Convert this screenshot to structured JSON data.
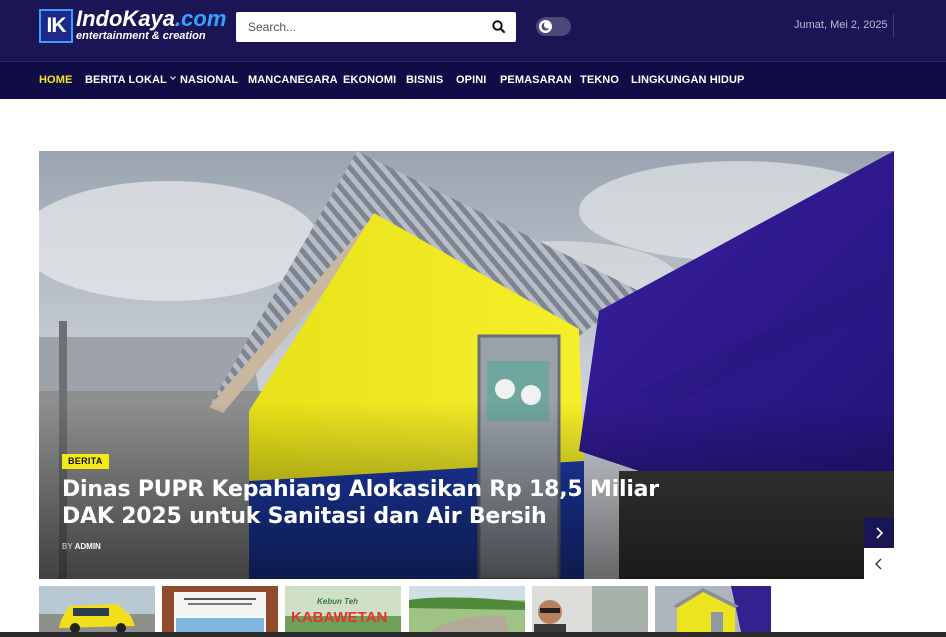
{
  "header": {
    "logo": {
      "mark": "IK",
      "name": "IndoKaya",
      "domain": ".com",
      "tagline": "entertainment & creation"
    },
    "search": {
      "placeholder": "Search...",
      "icon": "search-icon"
    },
    "dark_mode_toggle": {
      "icon": "moon-icon",
      "state": "off"
    },
    "date": "Jumat, Mei 2, 2025"
  },
  "nav": {
    "items": [
      {
        "label": "HOME",
        "active": true
      },
      {
        "label": "BERITA LOKAL",
        "has_dropdown": true
      },
      {
        "label": "NASIONAL"
      },
      {
        "label": "MANCANEGARA"
      },
      {
        "label": "EKONOMI"
      },
      {
        "label": "BISNIS"
      },
      {
        "label": "OPINI"
      },
      {
        "label": "PEMASARAN"
      },
      {
        "label": "TEKNO"
      },
      {
        "label": "LINGKUNGAN HIDUP"
      }
    ]
  },
  "hero": {
    "category": "BERITA",
    "title": "Dinas PUPR Kepahiang Alokasikan Rp 18,5 Miliar DAK 2025 untuk Sanitasi dan Air Bersih",
    "byline_prefix": "BY",
    "author": "ADMIN",
    "next_icon": "chevron-right-icon",
    "prev_icon": "chevron-left-icon"
  },
  "thumbnails": [
    {
      "name": "thumb-yellow-car"
    },
    {
      "name": "thumb-document-banner"
    },
    {
      "name": "thumb-kebun-teh-kabawetan",
      "text_line1": "Kebun Teh",
      "text_line2": "KABAWETAN"
    },
    {
      "name": "thumb-green-field"
    },
    {
      "name": "thumb-portrait"
    },
    {
      "name": "thumb-yellow-building"
    }
  ],
  "colors": {
    "header_bg": "#1a1656",
    "nav_bg": "#0f0c46",
    "accent_yellow": "#f3ea17"
  }
}
